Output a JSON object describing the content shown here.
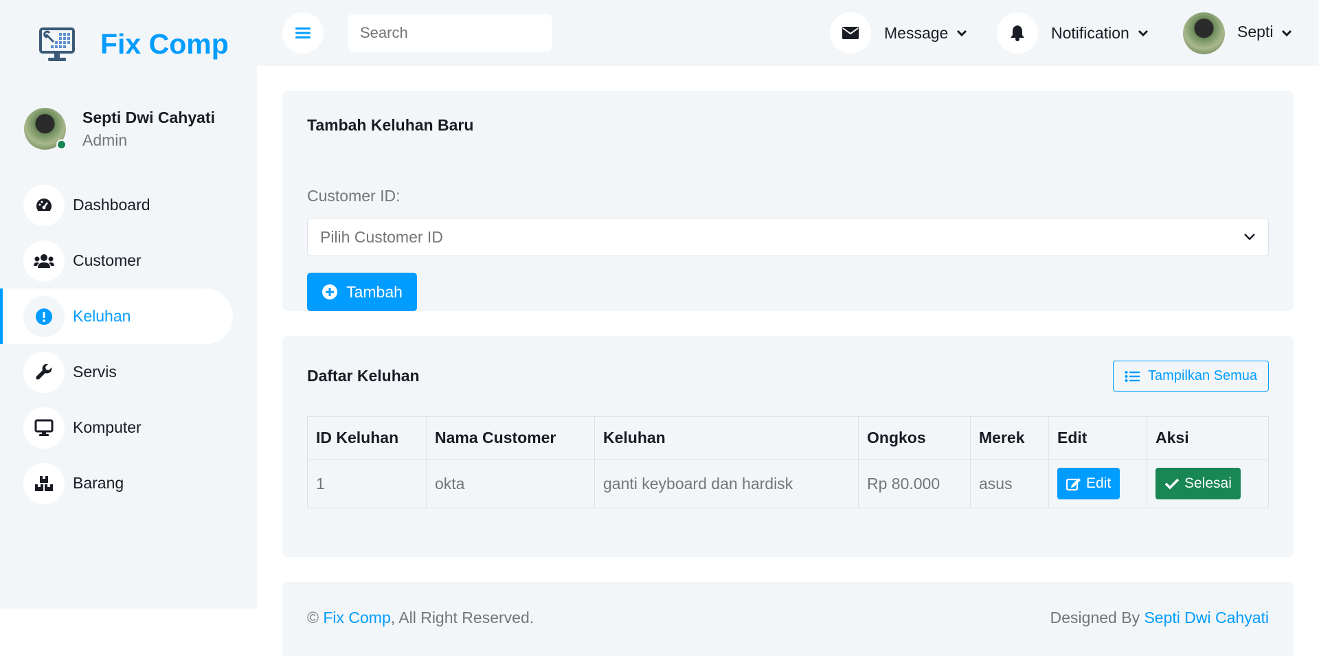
{
  "brand": {
    "name": "Fix Comp",
    "logo_icon": "computer-repair-icon"
  },
  "user": {
    "name": "Septi Dwi Cahyati",
    "role": "Admin",
    "status": "online"
  },
  "sidebar": {
    "items": [
      {
        "label": "Dashboard",
        "icon": "tachometer-icon",
        "active": false
      },
      {
        "label": "Customer",
        "icon": "users-icon",
        "active": false
      },
      {
        "label": "Keluhan",
        "icon": "exclamation-circle-icon",
        "active": true
      },
      {
        "label": "Servis",
        "icon": "wrench-icon",
        "active": false
      },
      {
        "label": "Komputer",
        "icon": "desktop-icon",
        "active": false
      },
      {
        "label": "Barang",
        "icon": "boxes-icon",
        "active": false
      }
    ]
  },
  "topbar": {
    "search_placeholder": "Search",
    "message_label": "Message",
    "notification_label": "Notification",
    "profile_label": "Septi"
  },
  "form": {
    "title": "Tambah Keluhan Baru",
    "customer_label": "Customer ID:",
    "customer_placeholder": "Pilih Customer ID",
    "submit_label": "Tambah"
  },
  "list": {
    "title": "Daftar Keluhan",
    "show_all_label": "Tampilkan Semua",
    "columns": [
      "ID Keluhan",
      "Nama Customer",
      "Keluhan",
      "Ongkos",
      "Merek",
      "Edit",
      "Aksi"
    ],
    "rows": [
      {
        "id": "1",
        "customer": "okta",
        "keluhan": "ganti keyboard dan hardisk",
        "ongkos": "Rp 80.000",
        "merek": "asus",
        "edit_label": "Edit",
        "action_label": "Selesai"
      }
    ]
  },
  "footer": {
    "copyright_symbol": "©",
    "brand_link": "Fix Comp",
    "rights": ", All Right Reserved.",
    "designed_by": "Designed By",
    "designer_link": "Septi Dwi Cahyati"
  },
  "colors": {
    "primary": "#009cff",
    "success": "#198754",
    "surface": "#f3f6f9",
    "text": "#191c24",
    "muted": "#757575"
  }
}
